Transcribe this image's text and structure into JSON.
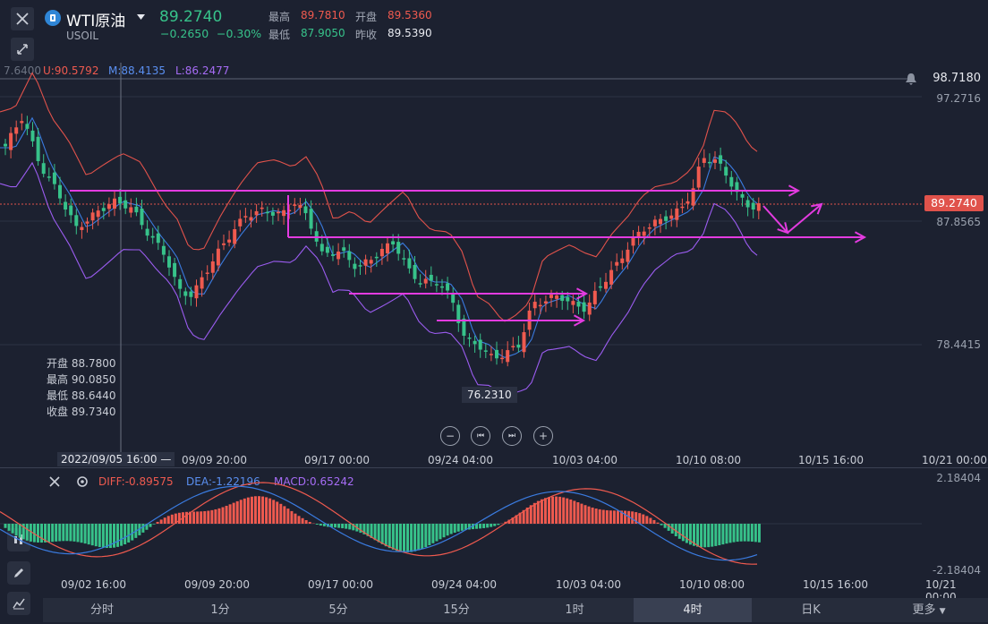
{
  "header": {
    "symbol": "WTI原油",
    "code": "USOIL",
    "price": "89.2740",
    "change": "−0.2650",
    "change_pct": "−0.30%",
    "stats": {
      "high_label": "最高",
      "high": "89.7810",
      "open_label": "开盘",
      "open": "89.5360",
      "low_label": "最低",
      "low": "87.9050",
      "prev_label": "昨收",
      "prev": "89.5390"
    }
  },
  "bollinger": {
    "top_value": "7.6400",
    "u": "U:90.5792",
    "m": "M:88.4135",
    "l": "L:86.2477"
  },
  "price_axis": {
    "alert_price": "98.7180",
    "p1": "97.2716",
    "current": "89.2740",
    "p2": "87.8565",
    "p3": "78.4415"
  },
  "cursor_ohlc": {
    "open_label": "开盘",
    "open": "88.7800",
    "high_label": "最高",
    "high": "90.0850",
    "low_label": "最低",
    "low": "88.6440",
    "close_label": "收盘",
    "close": "89.7340"
  },
  "low_marker": "76.2310",
  "cursor_date": "2022/09/05 16:00",
  "x_axis_main": [
    "09/09 20:00",
    "09/17 00:00",
    "09/24 04:00",
    "10/03 04:00",
    "10/10 08:00",
    "10/15 16:00",
    "10/21 00:00"
  ],
  "x_axis_macd": [
    "09/02 16:00",
    "09/09 20:00",
    "09/17 00:00",
    "09/24 04:00",
    "10/03 04:00",
    "10/10 08:00",
    "10/15 16:00",
    "10/21 00:00"
  ],
  "macd": {
    "diff": "DIFF:-0.89575",
    "dea": "DEA:-1.22196",
    "macd": "MACD:0.65242",
    "top": "2.18404",
    "bottom": "-2.18404"
  },
  "zoom": {
    "zoom_out": "−",
    "prev": "⏮",
    "next": "⏭",
    "zoom_in": "+"
  },
  "timeframes": [
    "分时",
    "1分",
    "5分",
    "15分",
    "1时",
    "4时",
    "日K",
    "更多"
  ],
  "active_timeframe": "4时",
  "colors": {
    "up": "#ef5a4f",
    "down": "#37c28a",
    "upper_band": "#e0524b",
    "mid_band": "#3a7be0",
    "lower_band": "#9b5cf0",
    "drawing": "#e33be0"
  }
}
